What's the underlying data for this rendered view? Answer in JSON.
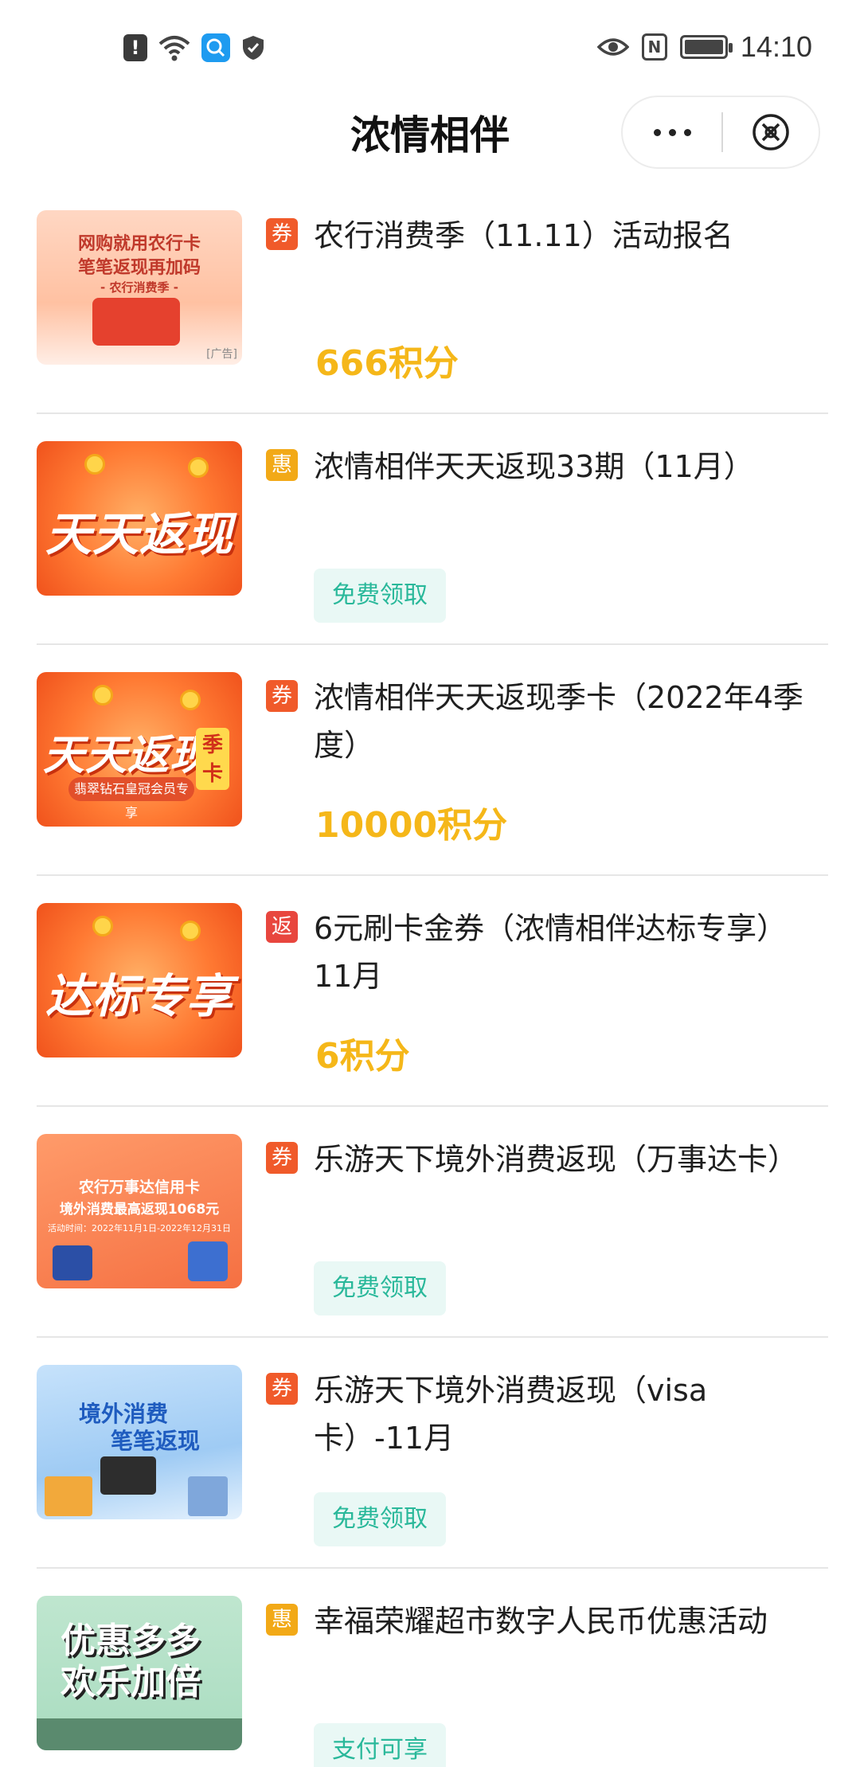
{
  "status_bar": {
    "time": "14:10",
    "left_icons": [
      "alert-icon",
      "wifi-icon",
      "search-app-icon",
      "shield-icon"
    ],
    "right_icons": [
      "eye-icon",
      "nfc-icon",
      "battery-icon"
    ]
  },
  "header": {
    "title": "浓情相伴",
    "more_icon": "more-dots-icon",
    "close_icon": "close-circle-icon"
  },
  "items": [
    {
      "tag": "券",
      "tag_type": "coupon",
      "title": "农行消费季（11.11）活动报名",
      "points": "666积分",
      "thumb": {
        "line1": "网购就用农行卡",
        "line2": "笔笔返现再加码",
        "line3": "- 农行消费季 -",
        "ad": "[广告]"
      }
    },
    {
      "tag": "惠",
      "tag_type": "discount",
      "title": "浓情相伴天天返现33期（11月）",
      "button": "免费领取",
      "thumb": {
        "word": "天天返现"
      }
    },
    {
      "tag": "券",
      "tag_type": "coupon",
      "title": "浓情相伴天天返现季卡（2022年4季度）",
      "points": "10000积分",
      "thumb": {
        "word": "天天返现",
        "badge": "季卡",
        "ribbon": "翡翠钻石皇冠会员专享"
      }
    },
    {
      "tag": "返",
      "tag_type": "refund",
      "title": "6元刷卡金券（浓情相伴达标专享）11月",
      "points": "6积分",
      "thumb": {
        "word": "达标专享"
      }
    },
    {
      "tag": "券",
      "tag_type": "coupon",
      "title": "乐游天下境外消费返现（万事达卡）",
      "button": "免费领取",
      "thumb": {
        "line1": "农行万事达信用卡",
        "line2": "境外消费最高返现1068元",
        "line3": "活动时间：2022年11月1日-2022年12月31日"
      }
    },
    {
      "tag": "券",
      "tag_type": "coupon",
      "title": "乐游天下境外消费返现（visa卡）-11月",
      "button": "免费领取",
      "thumb": {
        "line1": "境外消费",
        "line2": "笔笔返现"
      }
    },
    {
      "tag": "惠",
      "tag_type": "discount",
      "title": "幸福荣耀超市数字人民币优惠活动",
      "button": "支付可享",
      "thumb": {
        "line1": "优惠多多",
        "line2": "欢乐加倍"
      }
    }
  ]
}
